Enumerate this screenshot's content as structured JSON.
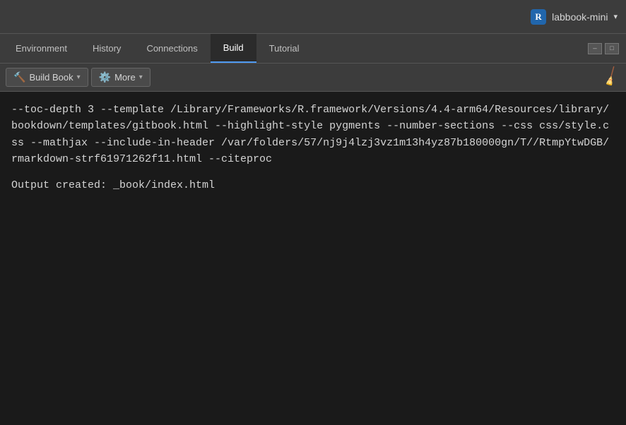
{
  "titlebar": {
    "r_logo": "R",
    "project_name": "labbook-mini",
    "dropdown_arrow": "▾"
  },
  "tabs": [
    {
      "id": "environment",
      "label": "Environment",
      "active": false
    },
    {
      "id": "history",
      "label": "History",
      "active": false
    },
    {
      "id": "connections",
      "label": "Connections",
      "active": false
    },
    {
      "id": "build",
      "label": "Build",
      "active": true
    },
    {
      "id": "tutorial",
      "label": "Tutorial",
      "active": false
    }
  ],
  "toolbar": {
    "build_book_label": "Build Book",
    "build_book_icon": "🔨",
    "more_label": "More",
    "more_icon": "⚙️",
    "dropdown_arrow": "▾",
    "broom_icon": "🧹"
  },
  "console": {
    "output": "--toc-depth 3 --template /Library/Frameworks/R.framework/Versions/4.4-arm64/Resources/library/bookdown/templates/gitbook.html --highlight-style pygments --number-sections --css css/style.css --mathjax --include-in-header /var/folders/57/nj9j4lzj3vz1m13h4yz87b180000gn/T//RtmpYtwDGB/rmarkdown-strf61971262f11.html --citeproc",
    "output_line": "Output created: _book/index.html"
  },
  "window_buttons": {
    "minimize": "—",
    "maximize": "□"
  }
}
